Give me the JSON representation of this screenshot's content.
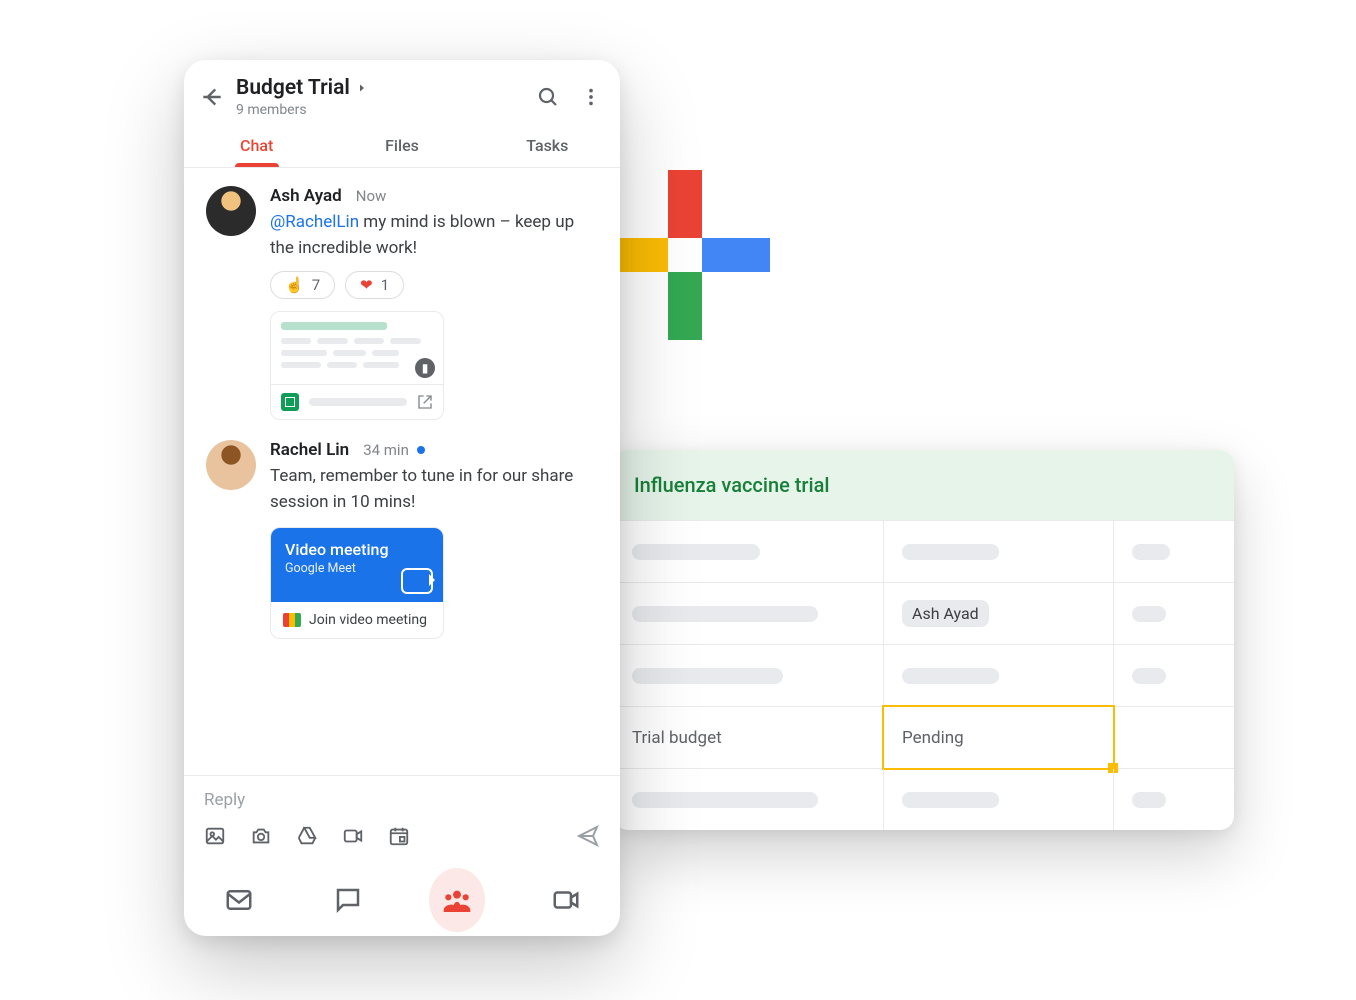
{
  "colors": {
    "accent": "#ea4335",
    "link": "#1a73e8",
    "green": "#188038",
    "yellow": "#fbbc04"
  },
  "plus": {
    "present": true
  },
  "sheets": {
    "title": "Influenza vaccine trial",
    "rows": [
      {
        "c0": null,
        "c1": null,
        "c2": null
      },
      {
        "c0": null,
        "c1_chip": "Ash Ayad",
        "c2": null
      },
      {
        "c0": null,
        "c1": null,
        "c2": null
      },
      {
        "c0_text": "Trial budget",
        "c1_text": "Pending",
        "selected": "c1",
        "c2": null
      },
      {
        "c0": null,
        "c1": null,
        "c2": null
      }
    ]
  },
  "phone": {
    "header": {
      "title": "Budget Trial",
      "subtitle": "9 members"
    },
    "tabs": [
      {
        "label": "Chat",
        "active": true
      },
      {
        "label": "Files",
        "active": false
      },
      {
        "label": "Tasks",
        "active": false
      }
    ],
    "messages": [
      {
        "author": "Ash Ayad",
        "time": "Now",
        "online": false,
        "mention": "@RachelLin",
        "text_rest": " my mind is blown – keep up the incredible work!",
        "reactions": [
          {
            "emoji": "☝️",
            "count": "7"
          },
          {
            "emoji": "❤",
            "count": "1",
            "heart": true
          }
        ],
        "attachment": {
          "kind": "sheets"
        }
      },
      {
        "author": "Rachel Lin",
        "time": "34 min",
        "online": true,
        "text": "Team, remember to tune in for our share session in 10 mins!",
        "meet": {
          "title": "Video meeting",
          "subtitle": "Google Meet",
          "action": "Join video meeting"
        }
      }
    ],
    "compose": {
      "placeholder": "Reply"
    },
    "bottom_nav": [
      {
        "name": "mail"
      },
      {
        "name": "chat"
      },
      {
        "name": "spaces",
        "active": true
      },
      {
        "name": "meet"
      }
    ]
  }
}
